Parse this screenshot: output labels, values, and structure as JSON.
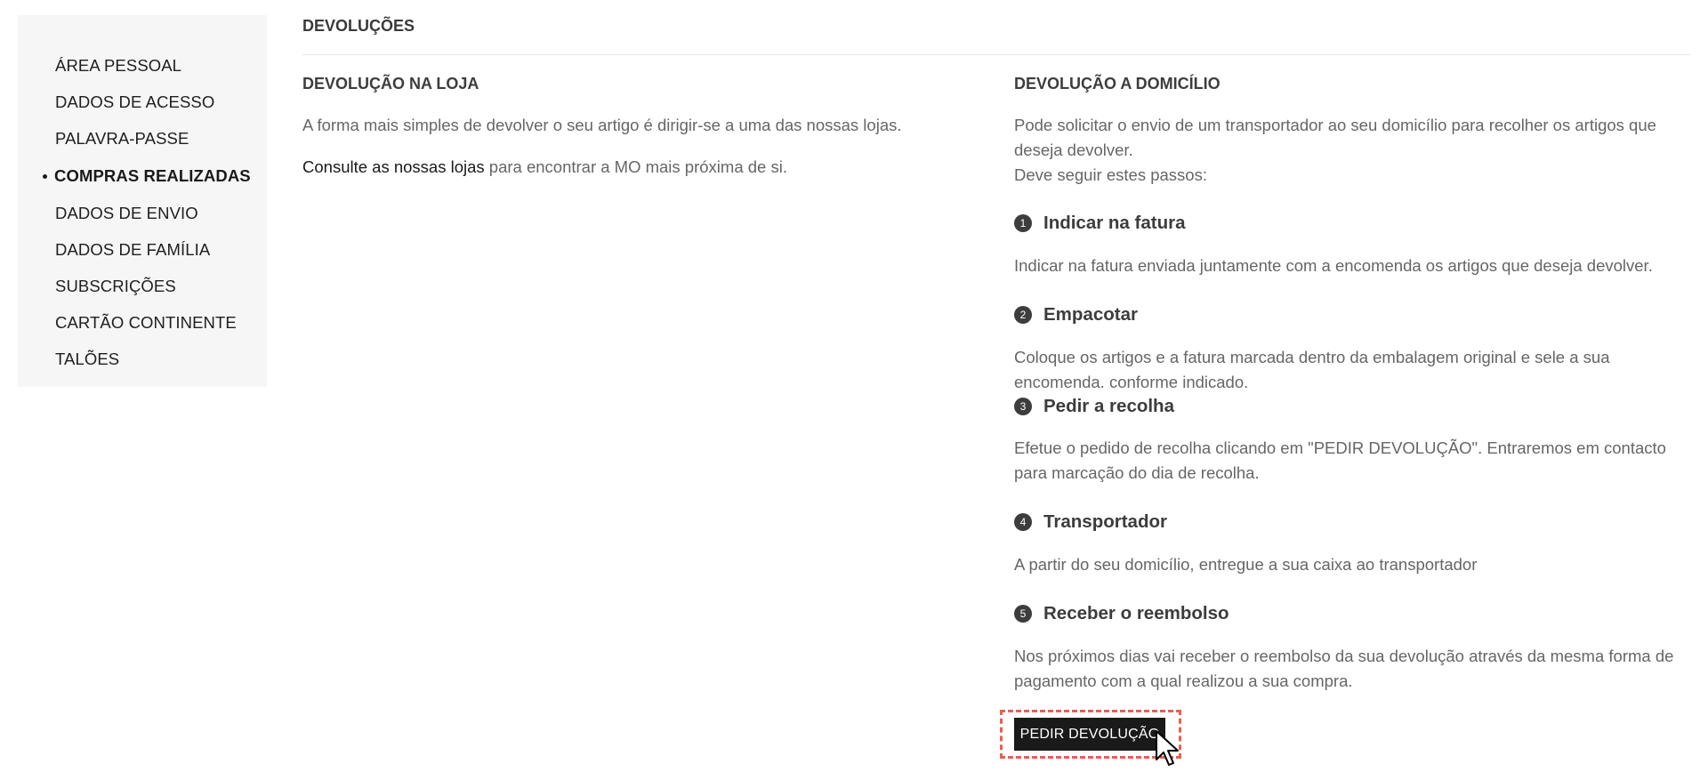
{
  "sidebar": {
    "items": [
      {
        "label": "ÁREA PESSOAL"
      },
      {
        "label": "DADOS DE ACESSO"
      },
      {
        "label": "PALAVRA-PASSE"
      },
      {
        "label": "COMPRAS REALIZADAS",
        "active": true
      },
      {
        "label": "DADOS DE ENVIO"
      },
      {
        "label": "DADOS DE FAMÍLIA"
      },
      {
        "label": "SUBSCRIÇÕES"
      },
      {
        "label": "CARTÃO CONTINENTE"
      },
      {
        "label": "TALÕES"
      }
    ]
  },
  "page": {
    "title": "DEVOLUÇÕES"
  },
  "store_return": {
    "title": "DEVOLUÇÃO NA LOJA",
    "text": "A forma mais simples de devolver o seu artigo é dirigir-se a uma das nossas lojas.",
    "link_text": "Consulte as nossas lojas",
    "link_suffix": " para encontrar a MO mais próxima de si."
  },
  "home_return": {
    "title": "DEVOLUÇÃO A DOMICÍLIO",
    "intro": "Pode solicitar o envio de um transportador ao seu domicílio para recolher os artigos que deseja devolver.",
    "intro2": "Deve seguir estes passos:",
    "steps": [
      {
        "number": "1",
        "title": "Indicar na fatura",
        "text": "Indicar na fatura enviada juntamente com a encomenda os artigos que deseja devolver."
      },
      {
        "number": "2",
        "title": "Empacotar",
        "text": "Coloque os artigos e a fatura marcada dentro da embalagem original e sele a sua encomenda, conforme indicado."
      },
      {
        "number": "3",
        "title": "Pedir a recolha",
        "text": "Efetue o pedido de recolha clicando em \"PEDIR DEVOLUÇÃO\". Entraremos em contacto para marcação do dia de recolha."
      },
      {
        "number": "4",
        "title": "Transportador",
        "text": "A partir do seu domicílio, entregue a sua caixa ao transportador"
      },
      {
        "number": "5",
        "title": "Receber o reembolso",
        "text": "Nos próximos dias vai receber o reembolso da sua devolução através da mesma forma de pagamento com a qual realizou a sua compra."
      }
    ],
    "button_label": "PEDIR DEVOLUÇÃO"
  },
  "colors": {
    "button_bg": "#1a1a1a",
    "highlight": "#e8604f",
    "sidebar_bg": "#f6f6f6"
  }
}
